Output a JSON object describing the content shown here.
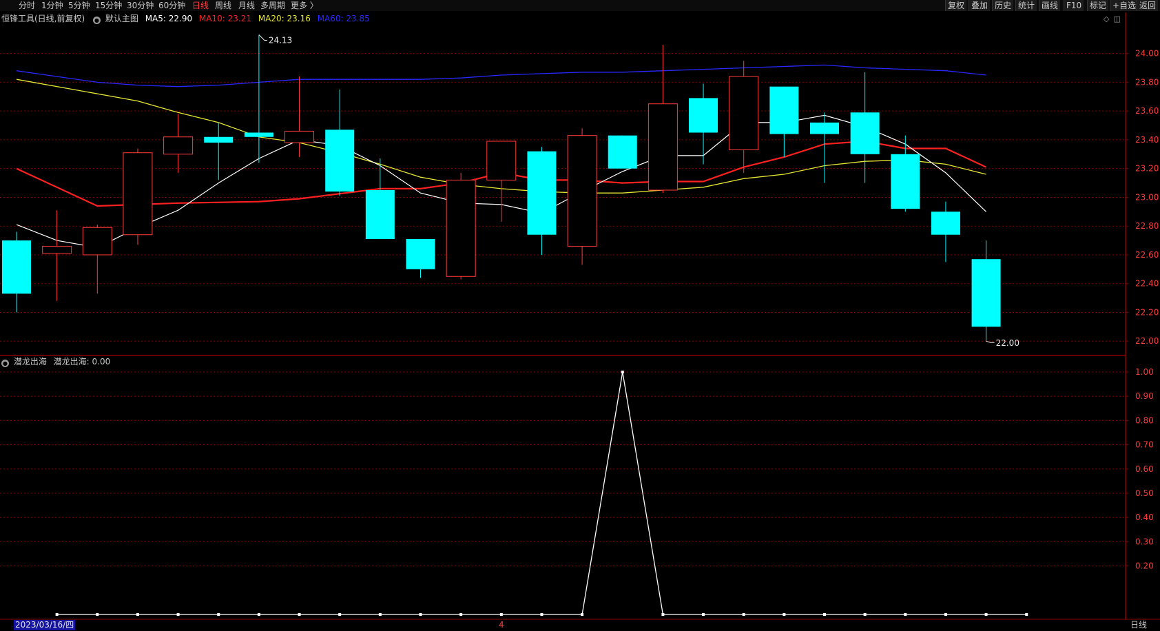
{
  "toolbar": {
    "periods": [
      "分时",
      "1分钟",
      "5分钟",
      "15分钟",
      "30分钟",
      "60分钟",
      "日线",
      "周线",
      "月线",
      "多周期",
      "更多 〉"
    ],
    "active_period": "日线",
    "right_buttons": [
      "复权",
      "叠加",
      "历史",
      "统计",
      "画线",
      "F10",
      "标记",
      "+自选",
      "返回"
    ]
  },
  "main_legend": {
    "title": "恒锋工具(日线,前复权)",
    "chart_name": "默认主图",
    "ma5": "MA5: 22.90",
    "ma10": "MA10: 23.21",
    "ma20": "MA20: 23.16",
    "ma60": "MA60: 23.85"
  },
  "sub_legend": {
    "indicator": "潜龙出海",
    "value": "潜龙出海: 0.00"
  },
  "footer": {
    "date": "2023/03/16/四",
    "cursor_day": "4",
    "period": "日线"
  },
  "colors": {
    "up": "#ff3b3b",
    "down": "#00ffff",
    "ma5": "#ffffff",
    "ma10": "#ff2020",
    "ma20": "#e6e632",
    "ma60": "#2828ff",
    "grid": "#8b0000",
    "axis": "#c8c8c8"
  },
  "chart_data": [
    {
      "type": "candlestick",
      "title": "恒锋工具(日线,前复权)",
      "y_ticks": [
        "24.00",
        "23.80",
        "23.60",
        "23.40",
        "23.20",
        "23.00",
        "22.80",
        "22.60",
        "22.40",
        "22.20",
        "22.00"
      ],
      "ylim": [
        21.91,
        24.19
      ],
      "max_label": "24.13",
      "min_label": "22.00",
      "candles": [
        {
          "o": 22.7,
          "h": 22.76,
          "l": 22.2,
          "c": 22.33
        },
        {
          "o": 22.61,
          "h": 22.91,
          "l": 22.28,
          "c": 22.66
        },
        {
          "o": 22.6,
          "h": 22.81,
          "l": 22.33,
          "c": 22.79
        },
        {
          "o": 22.74,
          "h": 23.34,
          "l": 22.67,
          "c": 23.31
        },
        {
          "o": 23.3,
          "h": 23.58,
          "l": 23.17,
          "c": 23.42
        },
        {
          "o": 23.42,
          "h": 23.52,
          "l": 23.12,
          "c": 23.38
        },
        {
          "o": 23.45,
          "h": 24.13,
          "l": 23.24,
          "c": 23.42
        },
        {
          "o": 23.38,
          "h": 23.84,
          "l": 23.28,
          "c": 23.46
        },
        {
          "o": 23.47,
          "h": 23.75,
          "l": 23.01,
          "c": 23.04
        },
        {
          "o": 23.05,
          "h": 23.27,
          "l": 23.05,
          "c": 22.71
        },
        {
          "o": 22.71,
          "h": 22.71,
          "l": 22.44,
          "c": 22.5
        },
        {
          "o": 22.45,
          "h": 23.17,
          "l": 22.43,
          "c": 23.12
        },
        {
          "o": 23.12,
          "h": 23.39,
          "l": 22.83,
          "c": 23.39
        },
        {
          "o": 23.32,
          "h": 23.35,
          "l": 22.6,
          "c": 22.74
        },
        {
          "o": 22.66,
          "h": 23.48,
          "l": 22.53,
          "c": 23.43
        },
        {
          "o": 23.43,
          "h": 23.43,
          "l": 23.2,
          "c": 23.2
        },
        {
          "o": 23.05,
          "h": 24.06,
          "l": 23.03,
          "c": 23.65
        },
        {
          "o": 23.69,
          "h": 23.79,
          "l": 23.23,
          "c": 23.45
        },
        {
          "o": 23.33,
          "h": 23.95,
          "l": 23.17,
          "c": 23.84
        },
        {
          "o": 23.77,
          "h": 23.77,
          "l": 23.28,
          "c": 23.44
        },
        {
          "o": 23.52,
          "h": 23.59,
          "l": 23.1,
          "c": 23.44
        },
        {
          "o": 23.59,
          "h": 23.87,
          "l": 23.1,
          "c": 23.3
        },
        {
          "o": 23.3,
          "h": 23.43,
          "l": 22.9,
          "c": 22.92
        },
        {
          "o": 22.9,
          "h": 22.97,
          "l": 22.55,
          "c": 22.74
        },
        {
          "o": 22.57,
          "h": 22.7,
          "l": 22.0,
          "c": 22.1
        }
      ],
      "ma5": [
        22.81,
        22.7,
        22.65,
        22.79,
        22.91,
        23.1,
        23.27,
        23.4,
        23.36,
        23.22,
        23.03,
        22.96,
        22.95,
        22.89,
        23.04,
        23.18,
        23.29,
        23.29,
        23.52,
        23.52,
        23.57,
        23.49,
        23.37,
        23.17,
        22.9
      ],
      "ma10": [
        23.2,
        null,
        22.94,
        null,
        22.96,
        null,
        22.97,
        22.99,
        null,
        23.06,
        23.06,
        23.1,
        23.17,
        23.12,
        23.12,
        23.1,
        23.11,
        23.11,
        23.21,
        23.28,
        23.37,
        23.39,
        23.34,
        23.34,
        23.21
      ],
      "ma20": [
        23.82,
        null,
        null,
        23.67,
        23.59,
        23.52,
        23.42,
        23.38,
        23.31,
        23.23,
        23.14,
        23.09,
        23.06,
        23.04,
        23.03,
        23.03,
        23.05,
        23.07,
        23.13,
        23.16,
        23.22,
        23.25,
        23.26,
        23.23,
        23.16
      ],
      "ma60": [
        23.88,
        23.84,
        23.8,
        23.78,
        23.77,
        23.78,
        23.8,
        23.82,
        23.82,
        23.82,
        23.82,
        23.83,
        23.85,
        23.86,
        23.87,
        23.87,
        23.88,
        23.89,
        23.9,
        23.91,
        23.92,
        23.9,
        23.89,
        23.88,
        23.85
      ]
    },
    {
      "type": "line",
      "title": "潜龙出海",
      "y_ticks": [
        "1.00",
        "0.90",
        "0.80",
        "0.70",
        "0.60",
        "0.50",
        "0.40",
        "0.30",
        "0.20"
      ],
      "ylim": [
        0,
        1.0
      ],
      "values": [
        0,
        0,
        0,
        0,
        0,
        0,
        0,
        0,
        0,
        0,
        0,
        0,
        0,
        0,
        1,
        0,
        0,
        0,
        0,
        0,
        0,
        0,
        0,
        0,
        0
      ]
    }
  ]
}
